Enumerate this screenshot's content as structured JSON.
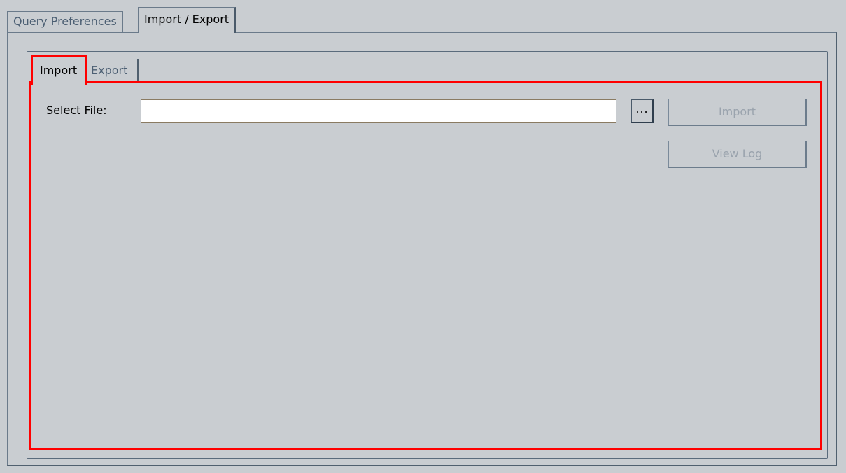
{
  "outer_tabs": [
    {
      "label": "Query Preferences",
      "active": false
    },
    {
      "label": "Import / Export",
      "active": true
    }
  ],
  "inner_tabs": [
    {
      "label": "Import",
      "active": true
    },
    {
      "label": "Export",
      "active": false
    }
  ],
  "import_panel": {
    "select_file_label": "Select File:",
    "file_value": "",
    "browse_label": "...",
    "import_button": "Import",
    "view_log_button": "View Log",
    "buttons_enabled": false
  },
  "highlight_color": "#ff0000"
}
